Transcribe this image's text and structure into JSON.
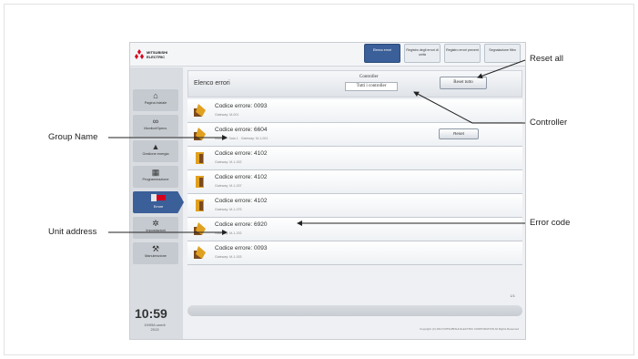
{
  "brand": {
    "name": "MITSUBISHI ELECTRIC"
  },
  "tabs": [
    {
      "label": "Elenco errori",
      "active": true
    },
    {
      "label": "Registro degli errori di unità",
      "active": false
    },
    {
      "label": "Registro errori prevent",
      "active": false
    },
    {
      "label": "Segnalazione filtro",
      "active": false
    }
  ],
  "sidebar": {
    "items": [
      {
        "label": "Pagina iniziale",
        "icon": "home-icon",
        "glyph": "⌂",
        "active": false
      },
      {
        "label": "Monitor/Opera.",
        "icon": "glasses-icon",
        "glyph": "∞",
        "active": false
      },
      {
        "label": "Gestione energia",
        "icon": "energy-icon",
        "glyph": "▲",
        "active": false
      },
      {
        "label": "Programmazione",
        "icon": "calendar-icon",
        "glyph": "▦",
        "active": false
      },
      {
        "label": "Errore",
        "icon": "error-icon",
        "glyph": "▮",
        "active": true
      },
      {
        "label": "Impostazioni",
        "icon": "gear-icon",
        "glyph": "✲",
        "active": false
      },
      {
        "label": "Manutenzione",
        "icon": "tools-icon",
        "glyph": "⚒",
        "active": false
      }
    ]
  },
  "clock": {
    "time": "10:59",
    "date": "19/05/Lunedì 2013"
  },
  "main": {
    "title": "Elenco errori",
    "controller_label": "Controller",
    "controller_value": "Tutti i controller",
    "reset_all_label": "Reset tutto",
    "row_reset_label": "Reset",
    "pager": "1/1",
    "copyright": "Copyright (C) 2013 MITSUBISHI ELECTRIC CORPORATION All Rights Reserved"
  },
  "errors": [
    {
      "code": "Codice errore: 0093",
      "sub": "Gateway: M-001",
      "has_reset": false
    },
    {
      "code": "Codice errore: 6604",
      "sub": "Indirizzo: Sala 1 · Gateway: M-1-001",
      "has_reset": true
    },
    {
      "code": "Codice errore: 4102",
      "sub": "Gateway: M-1-002",
      "has_reset": false
    },
    {
      "code": "Codice errore: 4102",
      "sub": "Gateway: M-1-007",
      "has_reset": false
    },
    {
      "code": "Codice errore: 4102",
      "sub": "Gateway: M-1-075",
      "has_reset": false
    },
    {
      "code": "Codice errore: 6920",
      "sub": "Gateway: M-1-202",
      "has_reset": false
    },
    {
      "code": "Codice errore: 0093",
      "sub": "Gateway: M-1-003",
      "has_reset": false
    }
  ],
  "annotations": {
    "reset_all": "Reset all",
    "controller": "Controller",
    "group_name": "Group Name",
    "unit_address": "Unit address",
    "error_code": "Error code"
  },
  "colors": {
    "accent": "#3b5f98",
    "icon_orange": "#e0a020",
    "icon_brown": "#7a4a1e"
  }
}
